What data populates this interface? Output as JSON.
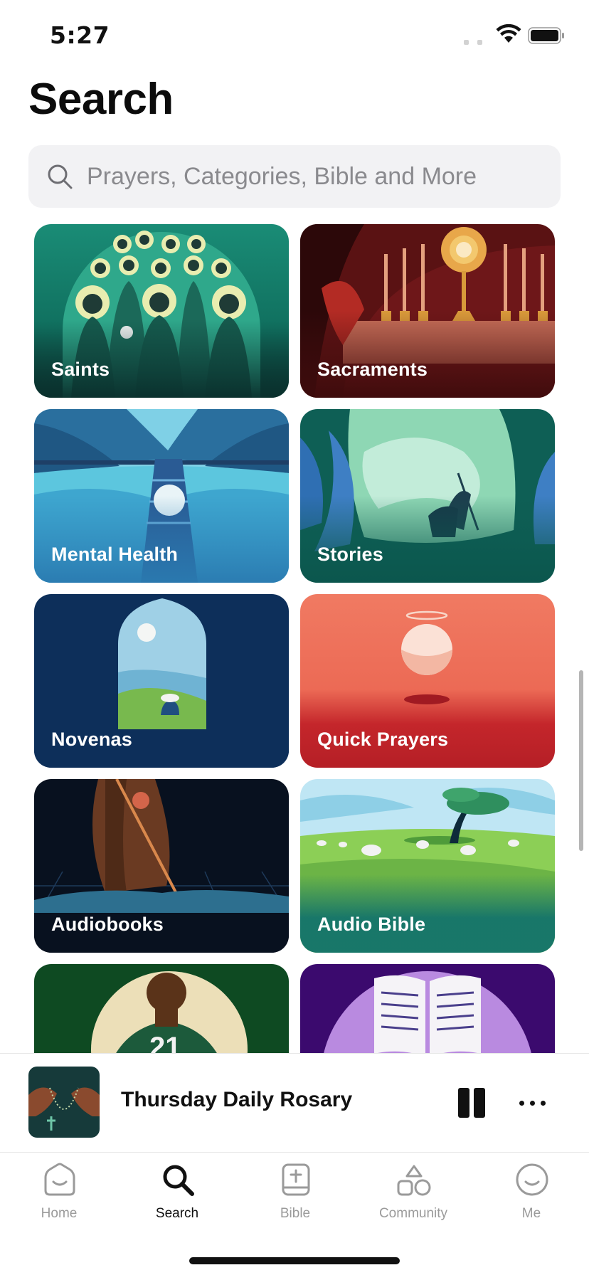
{
  "status_bar": {
    "time": "5:27"
  },
  "page": {
    "title": "Search"
  },
  "search": {
    "placeholder": "Prayers, Categories, Bible and More"
  },
  "categories": [
    {
      "label": "Saints"
    },
    {
      "label": "Sacraments"
    },
    {
      "label": "Mental Health"
    },
    {
      "label": "Stories"
    },
    {
      "label": "Novenas"
    },
    {
      "label": "Quick Prayers"
    },
    {
      "label": "Audiobooks"
    },
    {
      "label": "Audio Bible"
    },
    {
      "label": ""
    },
    {
      "label": ""
    }
  ],
  "now_playing": {
    "title": "Thursday Daily Rosary"
  },
  "tabs": [
    {
      "label": "Home",
      "icon": "home-icon",
      "active": false
    },
    {
      "label": "Search",
      "icon": "search-icon",
      "active": true
    },
    {
      "label": "Bible",
      "icon": "bible-icon",
      "active": false
    },
    {
      "label": "Community",
      "icon": "community-icon",
      "active": false
    },
    {
      "label": "Me",
      "icon": "me-icon",
      "active": false
    }
  ]
}
